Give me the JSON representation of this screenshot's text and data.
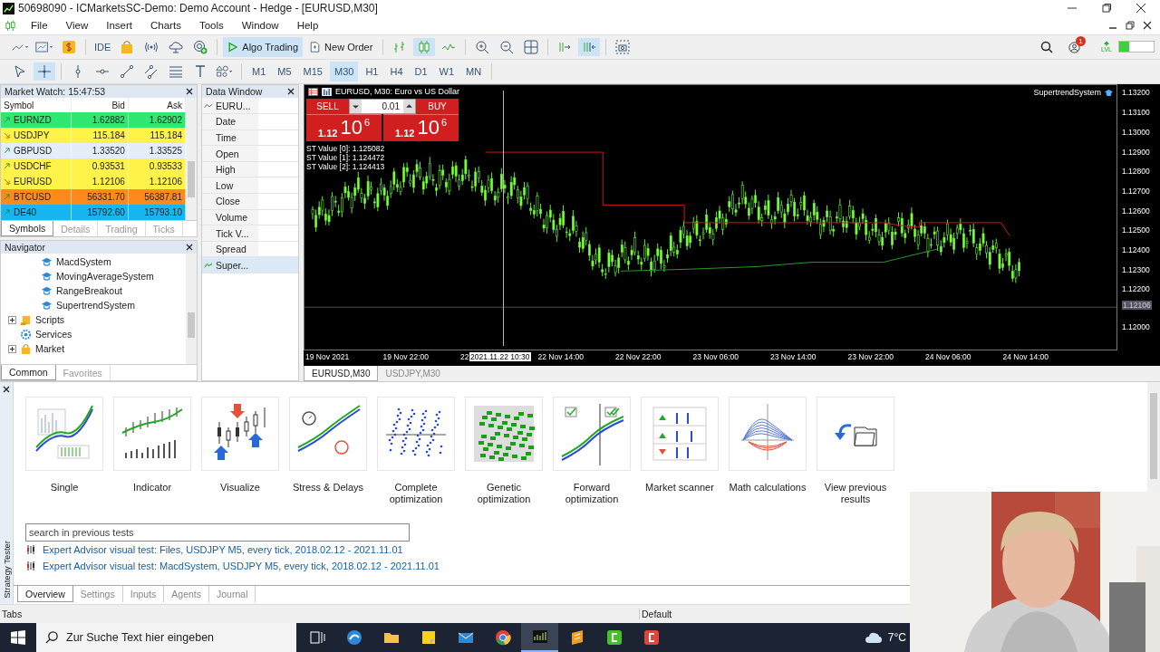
{
  "window": {
    "title": "50698090 - ICMarketsSC-Demo: Demo Account - Hedge - [EURUSD,M30]"
  },
  "menu": [
    "File",
    "View",
    "Insert",
    "Charts",
    "Tools",
    "Window",
    "Help"
  ],
  "toolbar": {
    "ide": "IDE",
    "algo_trading": {
      "label": "Algo Trading",
      "on": true
    },
    "new_order": "New Order",
    "notifications": "1",
    "level": "LVL",
    "chart_types": [
      {
        "kind": "bars",
        "selected": false
      },
      {
        "kind": "candles",
        "selected": true
      },
      {
        "kind": "line",
        "selected": false
      }
    ]
  },
  "timeframes": [
    {
      "label": "M1",
      "selected": false
    },
    {
      "label": "M5",
      "selected": false
    },
    {
      "label": "M15",
      "selected": false
    },
    {
      "label": "M30",
      "selected": true
    },
    {
      "label": "H1",
      "selected": false
    },
    {
      "label": "H4",
      "selected": false
    },
    {
      "label": "D1",
      "selected": false
    },
    {
      "label": "W1",
      "selected": false
    },
    {
      "label": "MN",
      "selected": false
    }
  ],
  "market_watch": {
    "title": "Market Watch: 15:47:53",
    "columns": [
      "Symbol",
      "Bid",
      "Ask"
    ],
    "rows": [
      {
        "symbol": "EURNZD",
        "rising": true,
        "bid": "1.62882",
        "ask": "1.62902",
        "color": "#2ee872"
      },
      {
        "symbol": "USDJPY",
        "rising": false,
        "bid": "115.184",
        "ask": "115.184",
        "color": "#fff34a"
      },
      {
        "symbol": "GBPUSD",
        "rising": true,
        "bid": "1.33520",
        "ask": "1.33525",
        "color": "#e3eefa"
      },
      {
        "symbol": "USDCHF",
        "rising": true,
        "bid": "0.93531",
        "ask": "0.93533",
        "color": "#fff34a"
      },
      {
        "symbol": "EURUSD",
        "rising": false,
        "bid": "1.12106",
        "ask": "1.12106",
        "color": "#fff34a"
      },
      {
        "symbol": "BTCUSD",
        "rising": true,
        "bid": "56331.70",
        "ask": "56387.81",
        "color": "#ff8a1c"
      },
      {
        "symbol": "DE40",
        "rising": true,
        "bid": "15792.60",
        "ask": "15793.10",
        "color": "#16b6f2"
      }
    ],
    "tabs": [
      {
        "label": "Symbols",
        "selected": true
      },
      {
        "label": "Details",
        "selected": false
      },
      {
        "label": "Trading",
        "selected": false
      },
      {
        "label": "Ticks",
        "selected": false
      }
    ]
  },
  "navigator": {
    "title": "Navigator",
    "items": [
      {
        "children": [
          {
            "label": "MacdSystem"
          },
          {
            "label": "MovingAverageSystem"
          },
          {
            "label": "RangeBreakout"
          },
          {
            "label": "SupertrendSystem"
          }
        ]
      },
      {
        "label": "Scripts",
        "kind": "scripts",
        "expanded": false
      },
      {
        "label": "Services",
        "kind": "services"
      },
      {
        "label": "Market",
        "kind": "market",
        "expanded": false
      }
    ],
    "tabs": [
      {
        "label": "Common",
        "selected": true
      },
      {
        "label": "Favorites",
        "selected": false
      }
    ]
  },
  "data_window": {
    "title": "Data Window",
    "rows": [
      {
        "label": "EURU...",
        "kind": "symbol",
        "selected": false
      },
      {
        "label": "Date",
        "selected": false
      },
      {
        "label": "Time",
        "selected": false
      },
      {
        "label": "Open",
        "selected": false
      },
      {
        "label": "High",
        "selected": false
      },
      {
        "label": "Low",
        "selected": false
      },
      {
        "label": "Close",
        "selected": false
      },
      {
        "label": "Volume",
        "selected": false
      },
      {
        "label": "Tick V...",
        "selected": false
      },
      {
        "label": "Spread",
        "selected": false
      },
      {
        "label": "Super...",
        "kind": "indicator",
        "selected": true
      }
    ]
  },
  "chart": {
    "title": "EURUSD, M30:  Euro vs US Dollar",
    "indicator": "SupertrendSystem",
    "trade_panel": {
      "sell": "SELL",
      "buy": "BUY",
      "lot": "0.01",
      "sell_price": {
        "big": "1.12",
        "pips": "10",
        "point": "6"
      },
      "buy_price": {
        "big": "1.12",
        "pips": "10",
        "point": "6"
      }
    },
    "st_values": [
      "ST Value [0]: 1.125082",
      "ST Value [1]: 1.124472",
      "ST Value [2]: 1.124413"
    ],
    "price_labels": [
      "1.13200",
      "1.13100",
      "1.13000",
      "1.12900",
      "1.12800",
      "1.12700",
      "1.12600",
      "1.12500",
      "1.12400",
      "1.12300",
      "1.12200",
      "1.12000"
    ],
    "current_price": "1.12106",
    "time_labels": [
      "19 Nov 2021",
      "19 Nov 22:00",
      "22",
      "22 Nov 14:00",
      "22 Nov 22:00",
      "23 Nov 06:00",
      "23 Nov 14:00",
      "23 Nov 22:00",
      "24 Nov 06:00",
      "24 Nov 14:00"
    ],
    "crosshair_time": "2021.11.22 10:30"
  },
  "chart_tabs": [
    {
      "label": "EURUSD,M30",
      "selected": true
    },
    {
      "label": "USDJPY,M30",
      "selected": false
    }
  ],
  "tester": {
    "label": "Strategy Tester",
    "modes": [
      {
        "label": "Single",
        "kind": "single"
      },
      {
        "label": "Indicator",
        "kind": "indicator"
      },
      {
        "label": "Visualize",
        "kind": "visualize"
      },
      {
        "label": "Stress & Delays",
        "kind": "stress"
      },
      {
        "label": "Complete optimization",
        "kind": "complete"
      },
      {
        "label": "Genetic optimization",
        "kind": "genetic"
      },
      {
        "label": "Forward optimization",
        "kind": "forward"
      },
      {
        "label": "Market scanner",
        "kind": "scanner"
      },
      {
        "label": "Math calculations",
        "kind": "math"
      },
      {
        "label": "View previous results",
        "kind": "previous"
      }
    ],
    "search": {
      "placeholder": "search in previous tests"
    },
    "history": [
      "Expert Advisor visual test: Files, USDJPY M5, every tick, 2018.02.12 - 2021.11.01",
      "Expert Advisor visual test: MacdSystem, USDJPY M5, every tick, 2018.02.12 - 2021.11.01"
    ],
    "tabs": [
      {
        "label": "Overview",
        "selected": true
      },
      {
        "label": "Settings",
        "selected": false
      },
      {
        "label": "Inputs",
        "selected": false
      },
      {
        "label": "Agents",
        "selected": false
      },
      {
        "label": "Journal",
        "selected": false
      }
    ]
  },
  "status_bar": [
    "Tabs",
    "Default"
  ],
  "taskbar": {
    "search": {
      "placeholder": "Zur Suche Text hier eingeben"
    },
    "apps": [
      {
        "kind": "task-view",
        "selected": false
      },
      {
        "kind": "browser",
        "selected": false
      },
      {
        "kind": "folder",
        "selected": false
      },
      {
        "kind": "notes",
        "selected": false
      },
      {
        "kind": "mail",
        "selected": false
      },
      {
        "kind": "chrome",
        "selected": false
      },
      {
        "kind": "trading",
        "selected": true
      },
      {
        "kind": "sublime",
        "selected": false
      },
      {
        "kind": "green-app",
        "selected": false
      },
      {
        "kind": "red-app",
        "selected": false
      }
    ],
    "weather": "7°C"
  },
  "webcam": {
    "kind": "picture"
  }
}
